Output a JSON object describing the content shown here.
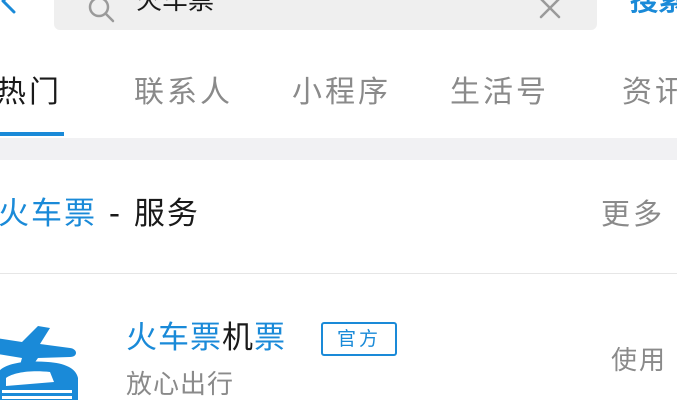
{
  "search": {
    "query": "火车票",
    "submit_label": "搜索"
  },
  "tabs": [
    {
      "label": "热门",
      "active": true
    },
    {
      "label": "联系人",
      "active": false
    },
    {
      "label": "小程序",
      "active": false
    },
    {
      "label": "生活号",
      "active": false
    },
    {
      "label": "资讯",
      "active": false
    }
  ],
  "section": {
    "title_highlight": "火车票",
    "title_rest": " - 服务",
    "more_label": "更多"
  },
  "result": {
    "title_highlight_1": "火车票",
    "title_middle": "机",
    "title_highlight_2": "票",
    "badge": "官方",
    "subtitle": "放心出行",
    "action_label": "使用"
  },
  "icons": {
    "back": "chevron-left-icon",
    "search": "search-icon",
    "clear": "close-icon",
    "app": "train-plane-app-icon"
  },
  "colors": {
    "accent": "#1a8ad8",
    "text_primary": "#1a1a1a",
    "text_secondary": "#8a8a8a",
    "search_bg": "#efefef",
    "band_bg": "#f1f1f3"
  }
}
